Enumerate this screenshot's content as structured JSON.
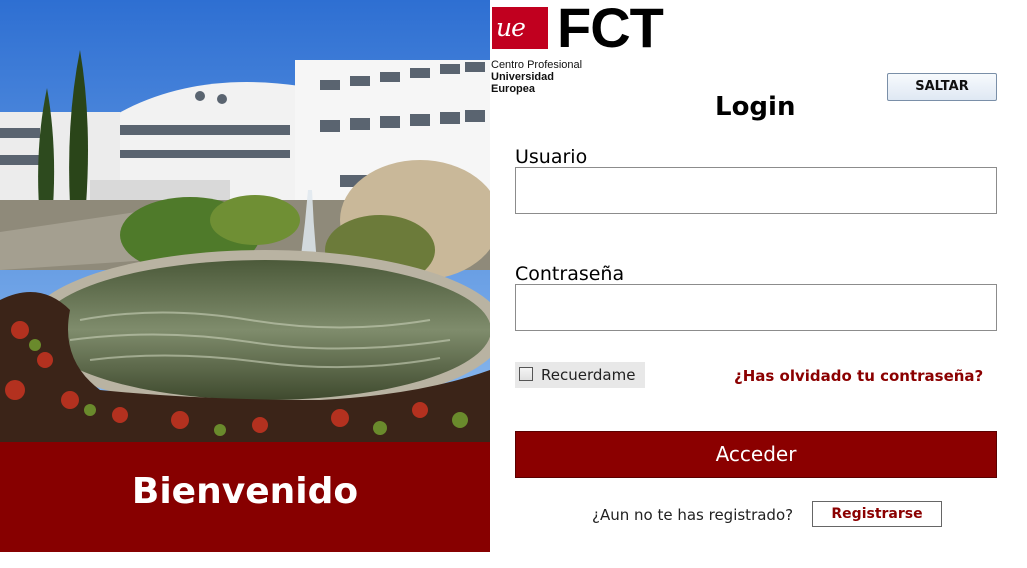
{
  "hero": {
    "welcome": "Bienvenido"
  },
  "logo": {
    "mark": "ue",
    "name": "FCT",
    "line1": "Centro Profesional",
    "line2": "Universidad",
    "line3": "Europea"
  },
  "form": {
    "skip_label": "SALTAR",
    "title": "Login",
    "username_label": "Usuario",
    "username_value": "",
    "password_label": "Contraseña",
    "password_value": "",
    "remember_label": "Recuerdame",
    "remember_checked": false,
    "forgot_link": "¿Has olvidado tu contraseña?",
    "submit_label": "Acceder",
    "register_question": "¿Aun no te has registrado?",
    "register_label": "Registrarse"
  },
  "colors": {
    "brand_red": "#870000",
    "logo_red": "#c1001f",
    "link_red": "#8b0000"
  },
  "icons": {
    "campus_photo": "campus-photo"
  }
}
